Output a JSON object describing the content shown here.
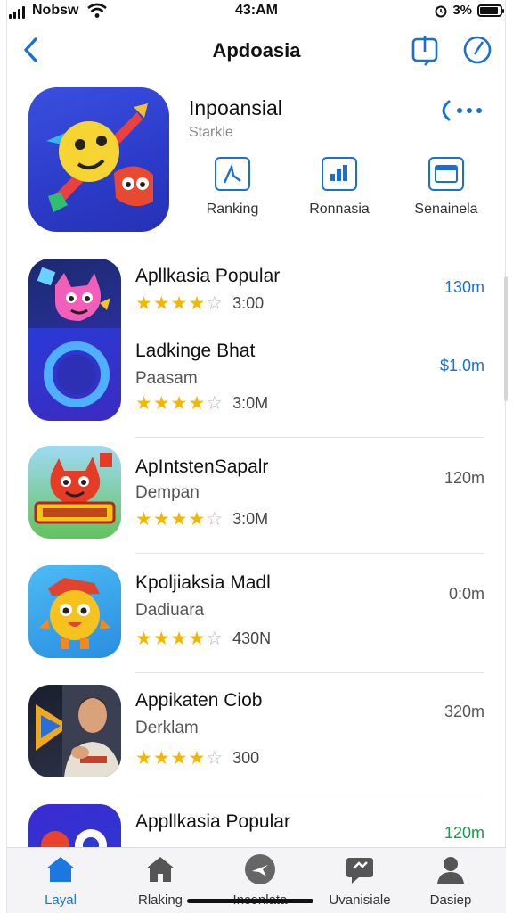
{
  "status": {
    "carrier": "Nobsw",
    "time": "43:AM",
    "battery": "3%",
    "battery_level": 0.9
  },
  "nav": {
    "title": "Apdoasia"
  },
  "hero": {
    "name": "Inpoansial",
    "subtitle": "Starkle",
    "more": "…",
    "actions": [
      {
        "label": "Ranking",
        "icon": "chart-line-icon"
      },
      {
        "label": "Ronnasia",
        "icon": "grid-icon"
      },
      {
        "label": "Senainela",
        "icon": "folder-icon"
      }
    ]
  },
  "apps": [
    {
      "name": "Apllkasia Popular",
      "subtitle": "",
      "rating_text": "3:00",
      "stars": 4.5,
      "price": "130m",
      "price_color": "#1a6fd6"
    },
    {
      "name": "Ladkinge Bhat",
      "subtitle": "Paasam",
      "rating_text": "3:0M",
      "stars": 4.5,
      "price": "$1.0m",
      "price_color": "#1a6fd6"
    },
    {
      "name": "ApIntstenSapalr",
      "subtitle": "Dempan",
      "rating_text": "3:0M",
      "stars": 4.5,
      "price": "120m",
      "price_color": "#555555"
    },
    {
      "name": "Kpoljiaksia Madl",
      "subtitle": "Dadiuara",
      "rating_text": "430N",
      "stars": 4.5,
      "price": "0:0m",
      "price_color": "#555555"
    },
    {
      "name": "Appikaten Ciob",
      "subtitle": "Derklam",
      "rating_text": "300",
      "stars": 4.5,
      "price": "320m",
      "price_color": "#555555"
    },
    {
      "name": "Appllkasia Popular",
      "subtitle": "",
      "rating_text": "",
      "stars": 0,
      "price": "120m",
      "price_color": "#1a9a4a"
    }
  ],
  "tabs": [
    {
      "label": "Layal",
      "icon": "home-icon",
      "active": true
    },
    {
      "label": "Rlaking",
      "icon": "ranking-house-icon",
      "active": false
    },
    {
      "label": "Inconlata",
      "icon": "plane-icon",
      "active": false
    },
    {
      "label": "Uvanisiale",
      "icon": "chat-icon",
      "active": false
    },
    {
      "label": "Dasiep",
      "icon": "profile-icon",
      "active": false
    }
  ],
  "colors": {
    "accent": "#1a78e0",
    "star": "#f2b705",
    "hero_bg": "#2b3bc8"
  }
}
